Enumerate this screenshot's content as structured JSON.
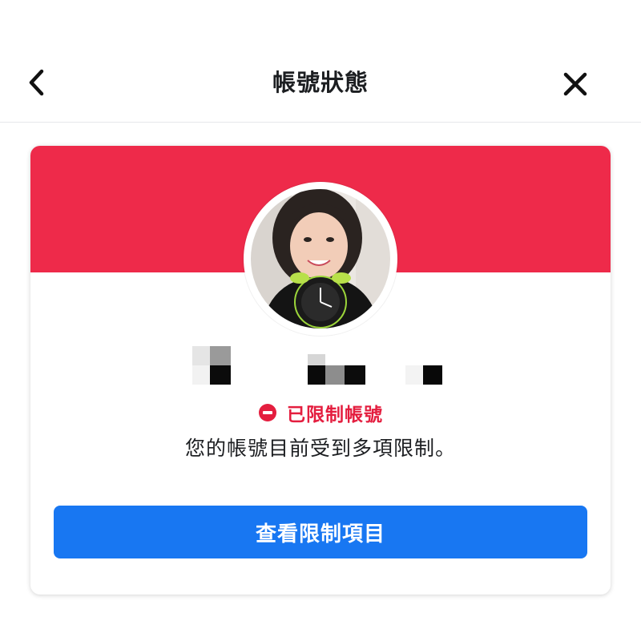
{
  "header": {
    "title": "帳號狀態",
    "back_icon": "chevron-left-icon",
    "close_icon": "close-icon"
  },
  "card": {
    "banner_color": "#ee2a4a",
    "status": {
      "icon": "restricted-icon",
      "label": "已限制帳號",
      "color": "#e41e3f"
    },
    "message": "您的帳號目前受到多項限制。",
    "button_label": "查看限制項目",
    "button_color": "#1877f2"
  }
}
